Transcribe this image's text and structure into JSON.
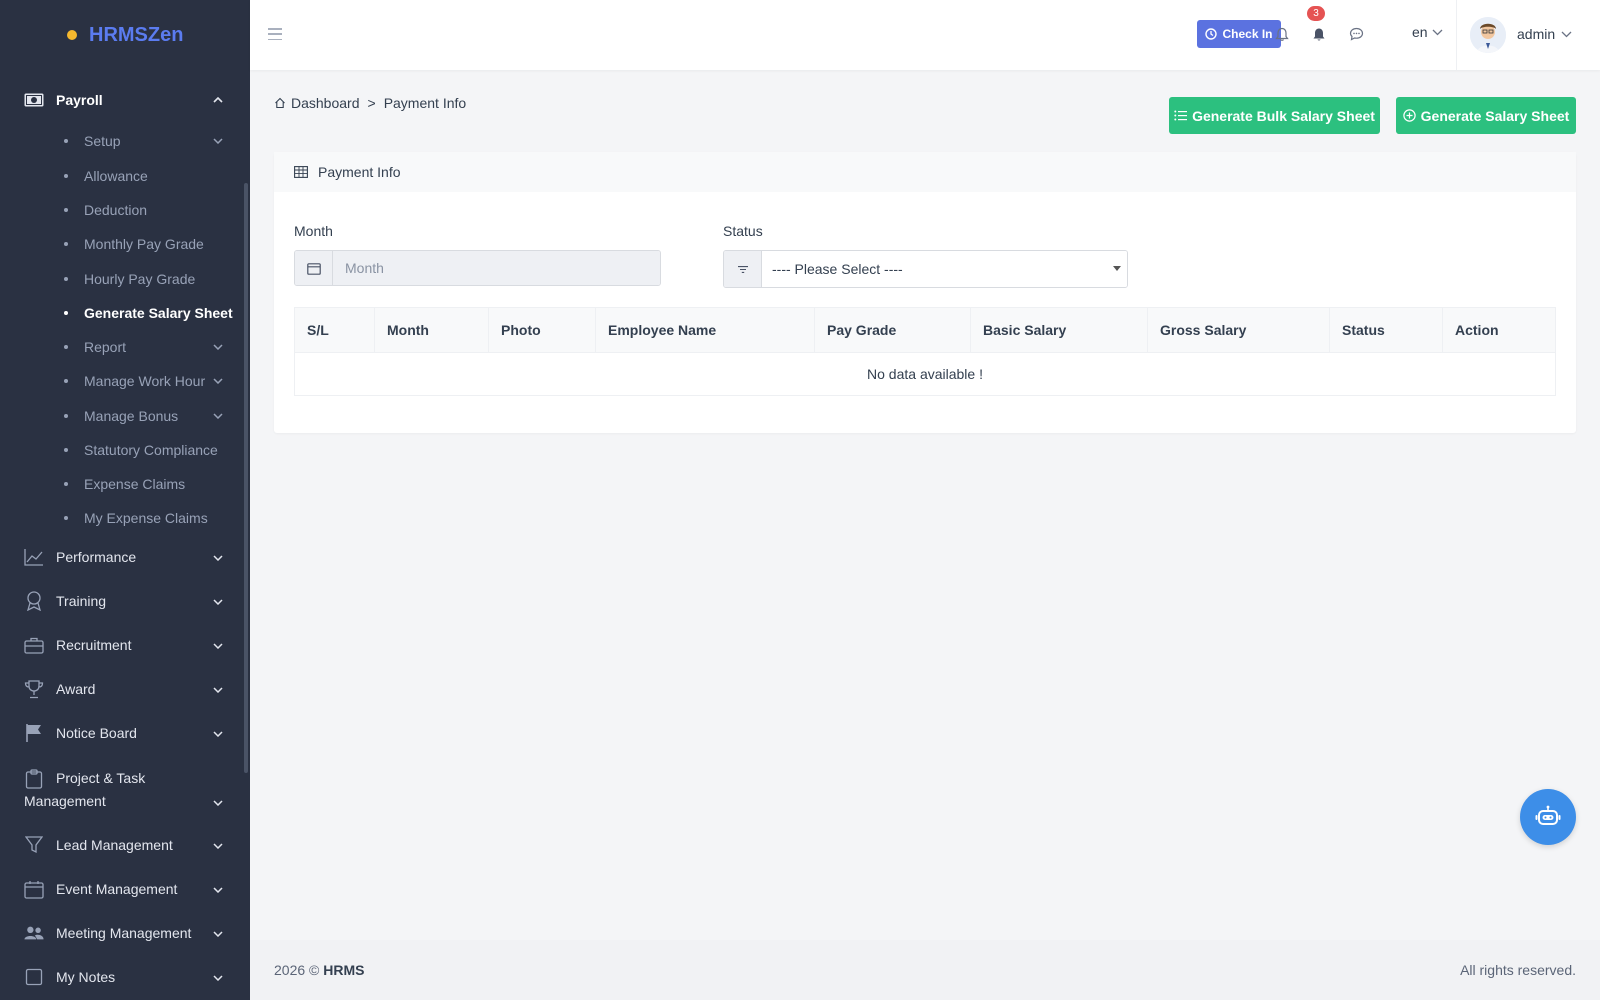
{
  "brand": {
    "name": "HRMSZen",
    "dot_color": "#f5b82e",
    "text_color": "#5b7cf0"
  },
  "sidebar": {
    "payroll": {
      "label": "Payroll",
      "icon": "money-icon"
    },
    "payroll_items": [
      {
        "label": "Setup",
        "has_children": true
      },
      {
        "label": "Allowance"
      },
      {
        "label": "Deduction"
      },
      {
        "label": "Monthly Pay Grade"
      },
      {
        "label": "Hourly Pay Grade"
      },
      {
        "label": "Generate Salary Sheet",
        "active": true
      },
      {
        "label": "Report",
        "has_children": true
      },
      {
        "label": "Manage Work Hour",
        "has_children": true
      },
      {
        "label": "Manage Bonus",
        "has_children": true
      },
      {
        "label": "Statutory Compliance"
      },
      {
        "label": "Expense Claims"
      },
      {
        "label": "My Expense Claims"
      }
    ],
    "groups": [
      {
        "label": "Performance",
        "icon": "chart-line-icon"
      },
      {
        "label": "Training",
        "icon": "award-ribbon-icon"
      },
      {
        "label": "Recruitment",
        "icon": "briefcase-icon"
      },
      {
        "label": "Award",
        "icon": "trophy-icon"
      },
      {
        "label": "Notice Board",
        "icon": "flag-icon"
      },
      {
        "label_line1": "Project & Task",
        "label_line2": "Management",
        "icon": "clipboard-icon"
      },
      {
        "label": "Lead Management",
        "icon": "funnel-icon"
      },
      {
        "label": "Event Management",
        "icon": "calendar-icon"
      },
      {
        "label": "Meeting Management",
        "icon": "users-icon"
      },
      {
        "label": "My Notes",
        "icon": "note-icon"
      }
    ]
  },
  "topbar": {
    "check_in": "Check In",
    "notification_count": "3",
    "language": "en",
    "user": "admin"
  },
  "breadcrumb": {
    "home": "Dashboard",
    "separator": ">",
    "current": "Payment Info"
  },
  "actions": {
    "bulk": "Generate Bulk Salary Sheet",
    "single": "Generate Salary Sheet",
    "color": "#2cc07f"
  },
  "card": {
    "title": "Payment Info",
    "month_label": "Month",
    "month_placeholder": "Month",
    "status_label": "Status",
    "status_selected": "---- Please Select ----"
  },
  "table": {
    "columns": [
      "S/L",
      "Month",
      "Photo",
      "Employee Name",
      "Pay Grade",
      "Basic Salary",
      "Gross Salary",
      "Status",
      "Action"
    ],
    "empty": "No data available !"
  },
  "footer": {
    "year": "2026 ©",
    "org": "HRMS",
    "rights": "All rights reserved."
  }
}
